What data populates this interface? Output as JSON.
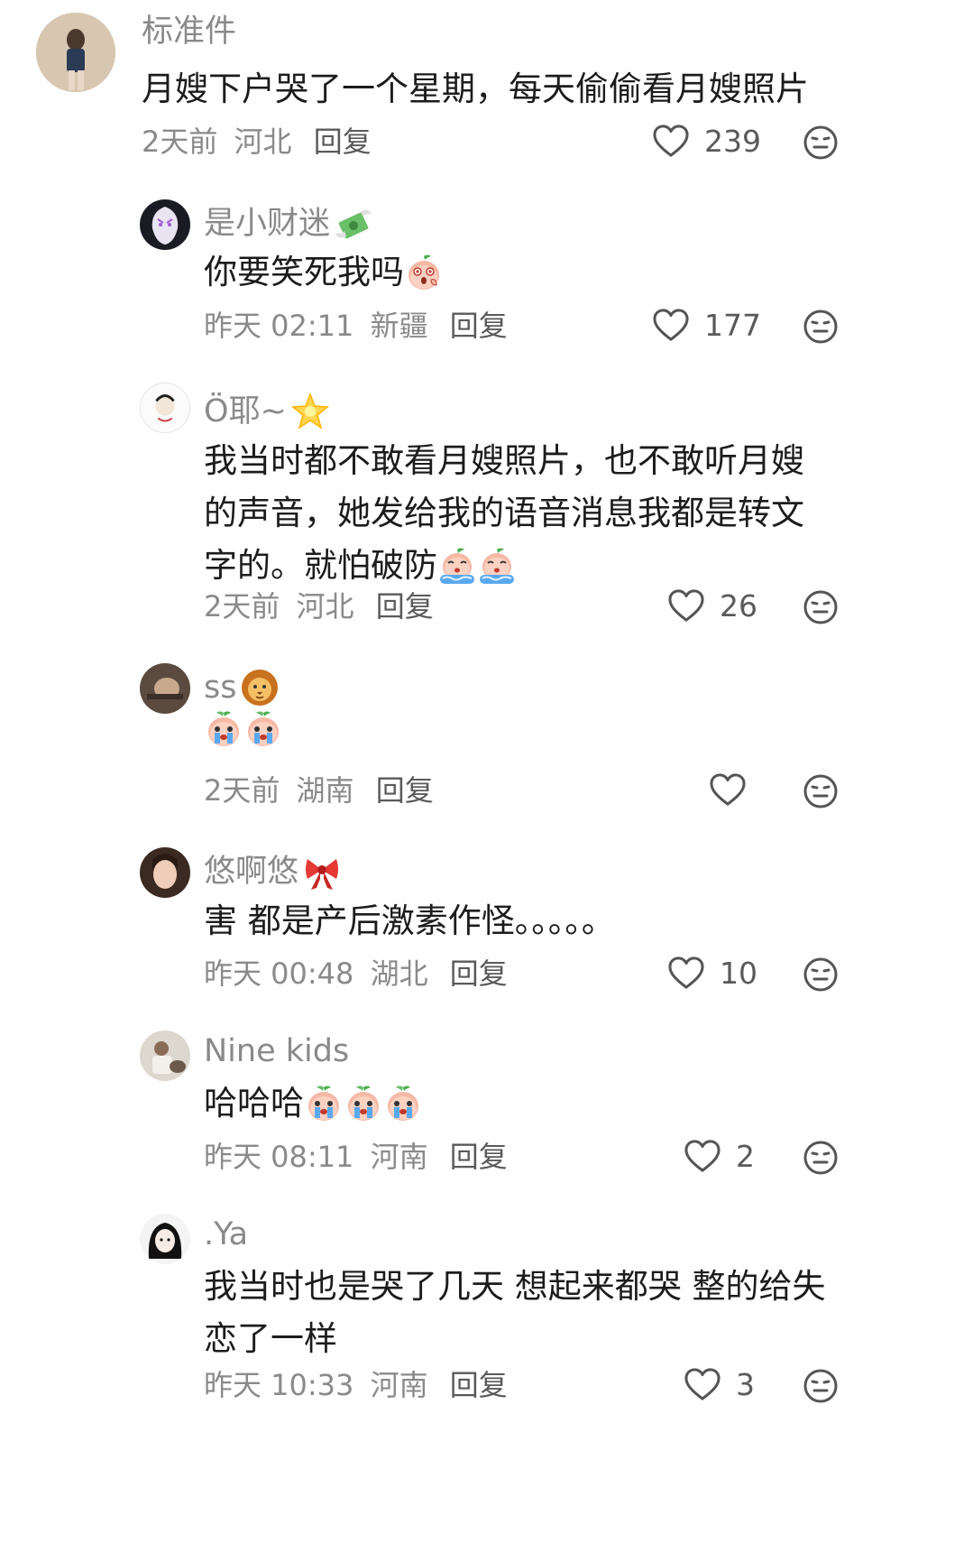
{
  "comments": [
    {
      "username": "标准件",
      "text": "月嫂下户哭了一个星期，每天偷偷看月嫂照片",
      "time": "2天前",
      "location": "河北",
      "reply_label": "回复",
      "likes": "239"
    },
    {
      "username": "是小财迷",
      "username_emoji": "money-wings-emoji",
      "text": "你要笑死我吗",
      "text_emojis": [
        "peach-gasp-emoji"
      ],
      "time": "昨天 02:11",
      "location": "新疆",
      "reply_label": "回复",
      "likes": "177"
    },
    {
      "username": "Ö耶~",
      "username_emoji": "glowing-star-emoji",
      "text_lines": [
        "我当时都不敢看月嫂照片，也不敢听月嫂",
        "的声音，她发给我的语音消息我都是转文",
        "字的。就怕破防"
      ],
      "text_emojis": [
        "peach-sob-emoji",
        "peach-sob-emoji"
      ],
      "time": "2天前",
      "location": "河北",
      "reply_label": "回复",
      "likes": "26"
    },
    {
      "username": "ss",
      "username_emoji": "lion-emoji",
      "text": "",
      "text_emojis": [
        "peach-cry-emoji",
        "peach-cry-emoji"
      ],
      "time": "2天前",
      "location": "湖南",
      "reply_label": "回复",
      "likes": ""
    },
    {
      "username": "悠啊悠",
      "username_emoji": "ribbon-emoji",
      "text": "害 都是产后激素作怪。。。。。",
      "time": "昨天 00:48",
      "location": "湖北",
      "reply_label": "回复",
      "likes": "10"
    },
    {
      "username": "Nine kids",
      "text": "哈哈哈",
      "text_emojis": [
        "peach-cry-emoji",
        "peach-cry-emoji",
        "peach-cry-emoji"
      ],
      "time": "昨天 08:11",
      "location": "河南",
      "reply_label": "回复",
      "likes": "2"
    },
    {
      "username": ".Ya",
      "text_lines": [
        "我当时也是哭了几天 想起来都哭 整的给失",
        "恋了一样"
      ],
      "time": "昨天 10:33",
      "location": "河南",
      "reply_label": "回复",
      "likes": "3"
    }
  ],
  "icons": {
    "like": "heart-outline-icon",
    "more": "neutral-face-icon"
  },
  "colors": {
    "username": "#8a8a8a",
    "body": "#1c1c1c",
    "meta": "#8a8a8a",
    "icon": "#555555"
  }
}
